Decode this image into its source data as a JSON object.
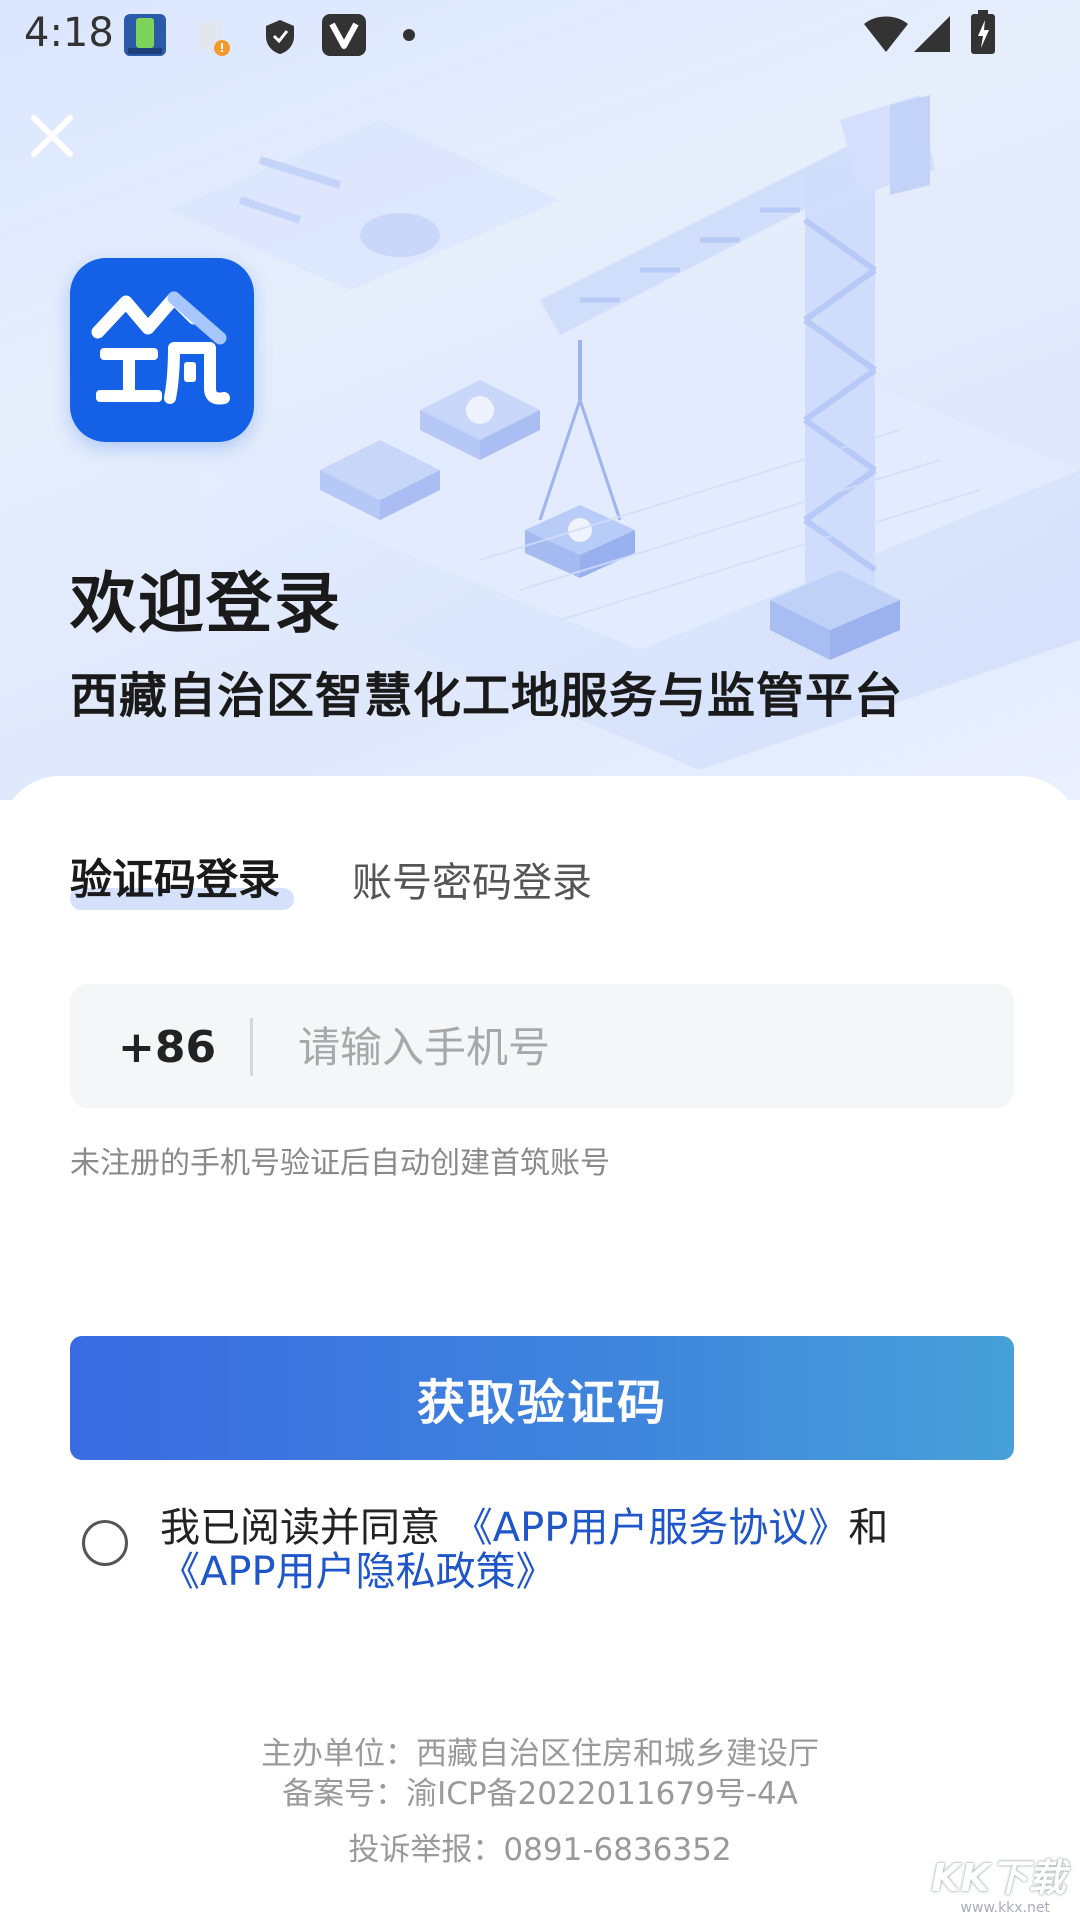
{
  "status_bar": {
    "time": "4:18"
  },
  "header": {
    "close_icon": "close-icon",
    "welcome_title": "欢迎登录",
    "platform_name": "西藏自治区智慧化工地服务与监管平台"
  },
  "login": {
    "tabs": [
      {
        "label": "验证码登录",
        "active": true
      },
      {
        "label": "账号密码登录",
        "active": false
      }
    ],
    "country_code": "+86",
    "phone_placeholder": "请输入手机号",
    "hint": "未注册的手机号验证后自动创建首筑账号",
    "get_code_label": "获取验证码",
    "agreement": {
      "prefix": "我已阅读并同意 ",
      "service_link": "《APP用户服务协议》",
      "joiner": "和",
      "privacy_link": "《APP用户隐私政策》",
      "checked": false
    }
  },
  "footer": {
    "sponsor": "主办单位：西藏自治区住房和城乡建设厅",
    "icp": "备案号：渝ICP备2022011679号-4A",
    "report": "投诉举报：0891-6836352"
  },
  "watermark": "KK下载",
  "watermark_sub": "www.kkx.net",
  "colors": {
    "accent": "#3a6be2",
    "link": "#1f56c8",
    "logo_bg": "#1460e6"
  }
}
